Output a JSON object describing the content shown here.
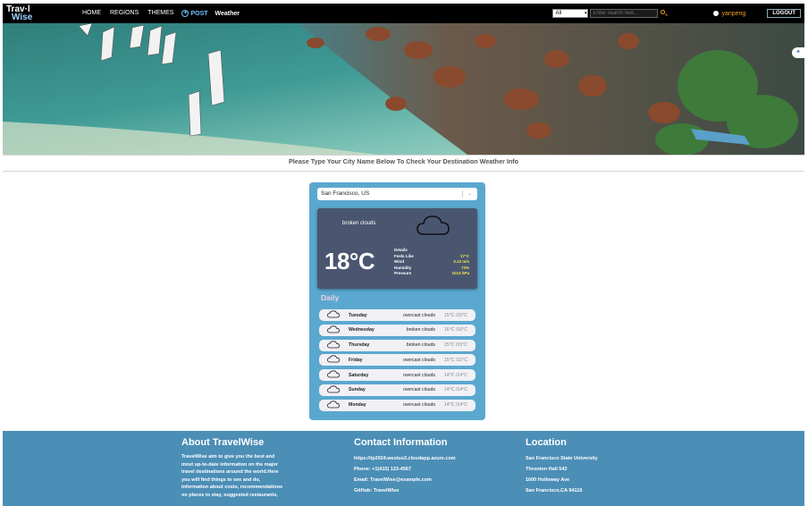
{
  "nav": {
    "logo_line1": "Trav·l",
    "logo_line2": "Wise",
    "links": [
      "HOME",
      "REGIONS",
      "THEMES"
    ],
    "post_label": "POST",
    "weather_label": "Weather",
    "filter_value": "All",
    "search_placeholder": "Enter search text...",
    "username": "yanpeng",
    "logout_label": "LOGOUT"
  },
  "prompt": "Please Type Your City Name Below To Check Your Destination Weather Info",
  "weather": {
    "city": "San Francisco, US",
    "current": {
      "description": "broken clouds",
      "temperature": "18°C",
      "details_header": "Details",
      "details": [
        {
          "label": "Feels Like",
          "value": "17°C"
        },
        {
          "label": "Wind",
          "value": "3.13 m/s"
        },
        {
          "label": "Humidity",
          "value": "73%"
        },
        {
          "label": "Pressure",
          "value": "1013 hPa"
        }
      ]
    },
    "daily_header": "Daily",
    "daily": [
      {
        "day": "Tuesday",
        "condition": "overcast clouds",
        "temps": "15°C /15°C"
      },
      {
        "day": "Wednesday",
        "condition": "broken clouds",
        "temps": "16°C /16°C"
      },
      {
        "day": "Thursday",
        "condition": "broken clouds",
        "temps": "15°C /15°C"
      },
      {
        "day": "Friday",
        "condition": "overcast clouds",
        "temps": "15°C /15°C"
      },
      {
        "day": "Saturday",
        "condition": "overcast clouds",
        "temps": "14°C /14°C"
      },
      {
        "day": "Sunday",
        "condition": "overcast clouds",
        "temps": "14°C /14°C"
      },
      {
        "day": "Monday",
        "condition": "overcast clouds",
        "temps": "14°C /14°C"
      }
    ]
  },
  "footer": {
    "about": {
      "title": "About TravelWise",
      "lines": [
        "TravelWise aim to give you the best and",
        "most up-to-date information on the major",
        "travel destinations around the world.Here",
        "you will find things to see and do,",
        "information about costs, recommendations",
        "on places to stay, suggested restaurants,"
      ]
    },
    "contact": {
      "title": "Contact Information",
      "items": [
        "https://tp2024.westus3.cloudapp.azure.com",
        "Phone: +1(415) 123-4567",
        "Email: TravelWise@example.com",
        "GitHub: TravelWise"
      ]
    },
    "location": {
      "title": "Location",
      "items": [
        "San Francisco State University",
        "Thronton Hall 543",
        "1600 Holloway Ave",
        "San Francisco,CA 94116"
      ]
    }
  },
  "colors": {
    "nav_bg": "#000000",
    "accent": "#f0a020",
    "card_bg": "#5aa8cf",
    "current_bg": "#4a5670",
    "footer_bg": "#4b8eb6",
    "detail_value": "#f3e84a"
  }
}
